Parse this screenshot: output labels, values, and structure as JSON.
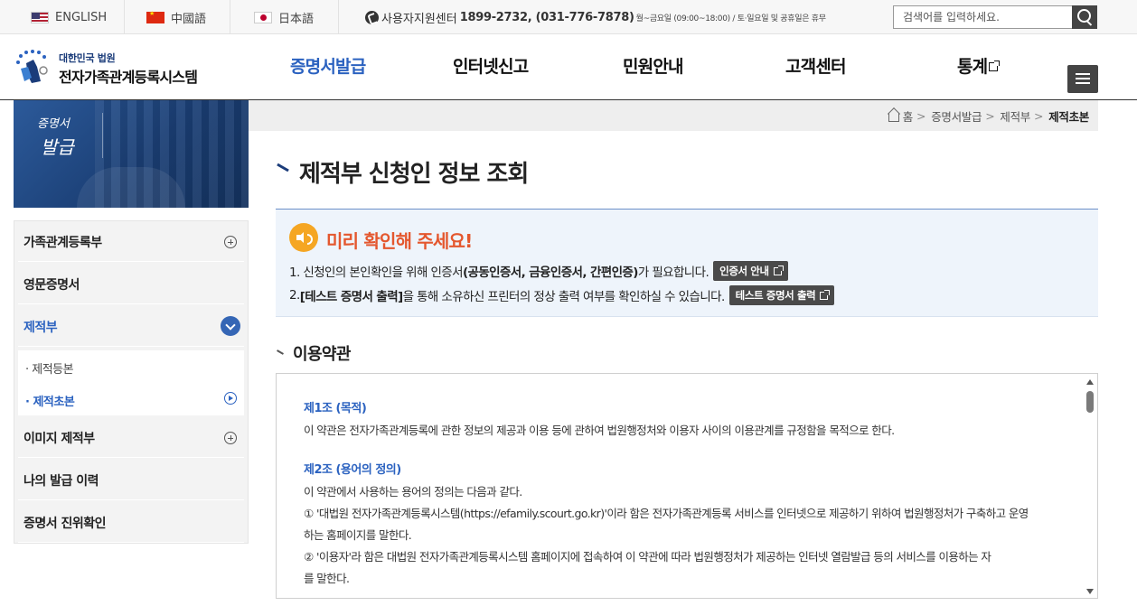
{
  "topbar": {
    "languages": [
      "ENGLISH",
      "中國語",
      "日本語"
    ],
    "support_label": "사용자지원센터",
    "support_phone": "1899-2732, (031-776-7878)",
    "support_hours": "월~금요일 (09:00~18:00) / 토·일요일 및 공휴일은 휴무",
    "search_placeholder": "검색어를 입력하세요."
  },
  "header": {
    "logo_sub": "대한민국 법원",
    "logo_title": "전자가족관계등록시스템",
    "nav": [
      "증명서발급",
      "인터넷신고",
      "민원안내",
      "고객센터",
      "통계"
    ]
  },
  "sidebar": {
    "banner_small": "증명서",
    "banner_large": "발급",
    "items": [
      "가족관계등록부",
      "영문증명서",
      "제적부",
      "이미지 제적부",
      "나의 발급 이력",
      "증명서 진위확인"
    ],
    "sub_items": [
      "제적등본",
      "제적초본"
    ]
  },
  "breadcrumb": {
    "items": [
      "홈",
      "증명서발급",
      "제적부",
      "제적초본"
    ]
  },
  "main": {
    "title": "제적부 신청인 정보 조회",
    "notice": {
      "title": "미리 확인해 주세요!",
      "line1_a": "1. 신청인의 본인확인을 위해 인증서",
      "line1_b": "(공동인증서, 금융인증서, 간편인증)",
      "line1_c": "가 필요합니다.",
      "line1_button": "인증서 안내",
      "line2_a": "2. ",
      "line2_b": "[테스트 증명서 출력]",
      "line2_c": "을 통해 소유하신 프린터의 정상 출력 여부를 확인하실 수 있습니다.",
      "line2_button": "테스트 증명서 출력"
    },
    "terms_title": "이용약관",
    "terms": {
      "art1_head": "제1조 (목적)",
      "art1_text": "이 약관은 전자가족관계등록에 관한 정보의 제공과 이용 등에 관하여 법원행정처와 이용자 사이의 이용관계를 규정함을 목적으로 한다.",
      "art2_head": "제2조 (용어의 정의)",
      "art2_intro": "이 약관에서 사용하는 용어의 정의는 다음과 같다.",
      "art2_item1_a": "① '대법원 전자가족관계등록시스템(https://efamily.scourt.go.kr)'이라 함은 전자가족관계등록 서비스를 인터넷으로 제공하기 위하여 법원행정처가 구축하고 운영",
      "art2_item1_b": "하는 홈페이지를 말한다.",
      "art2_item2_a": "② '이용자'라 함은 대법원 전자가족관계등록시스템 홈페이지에 접속하여 이 약관에 따라 법원행정처가 제공하는 인터넷 열람발급 등의 서비스를 이용하는 자",
      "art2_item2_b": "를 말한다."
    }
  }
}
